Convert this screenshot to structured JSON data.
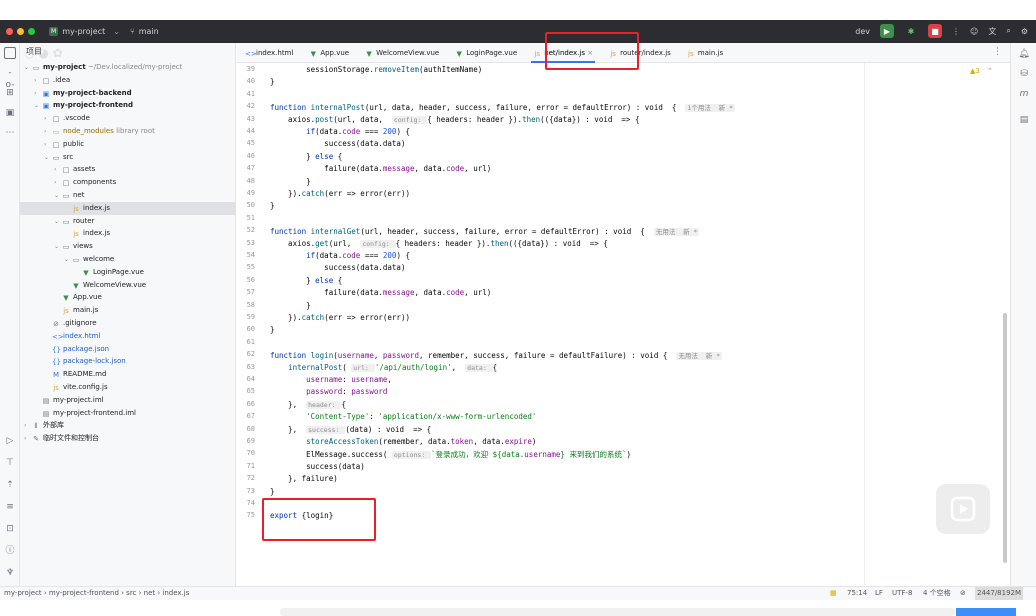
{
  "window": {
    "project_badge": "M",
    "project_name": "my-project",
    "branch": "main",
    "run_config": "dev"
  },
  "project_panel": {
    "title": "项目",
    "tree": [
      {
        "label": "my-project",
        "hint": "~/Dev.localized/my-project",
        "depth": 0,
        "kind": "folder-open",
        "bold": true
      },
      {
        "label": ".idea",
        "depth": 1,
        "kind": "folder"
      },
      {
        "label": "my-project-backend",
        "depth": 1,
        "kind": "module",
        "bold": true
      },
      {
        "label": "my-project-frontend",
        "depth": 1,
        "kind": "module-open",
        "bold": true
      },
      {
        "label": ".vscode",
        "depth": 2,
        "kind": "folder"
      },
      {
        "label": "node_modules",
        "hint": "library root",
        "depth": 2,
        "kind": "folder-lib"
      },
      {
        "label": "public",
        "depth": 2,
        "kind": "folder"
      },
      {
        "label": "src",
        "depth": 2,
        "kind": "folder-open"
      },
      {
        "label": "assets",
        "depth": 3,
        "kind": "folder"
      },
      {
        "label": "components",
        "depth": 3,
        "kind": "folder"
      },
      {
        "label": "net",
        "depth": 3,
        "kind": "folder-open"
      },
      {
        "label": "index.js",
        "depth": 4,
        "kind": "js",
        "selected": true
      },
      {
        "label": "router",
        "depth": 3,
        "kind": "folder-open"
      },
      {
        "label": "index.js",
        "depth": 4,
        "kind": "js"
      },
      {
        "label": "views",
        "depth": 3,
        "kind": "folder-open"
      },
      {
        "label": "welcome",
        "depth": 4,
        "kind": "folder-open"
      },
      {
        "label": "LoginPage.vue",
        "depth": 5,
        "kind": "vue"
      },
      {
        "label": "WelcomeView.vue",
        "depth": 4,
        "kind": "vue"
      },
      {
        "label": "App.vue",
        "depth": 3,
        "kind": "vue"
      },
      {
        "label": "main.js",
        "depth": 3,
        "kind": "js"
      },
      {
        "label": ".gitignore",
        "depth": 2,
        "kind": "git"
      },
      {
        "label": "index.html",
        "depth": 2,
        "kind": "html"
      },
      {
        "label": "package.json",
        "depth": 2,
        "kind": "json"
      },
      {
        "label": "package-lock.json",
        "depth": 2,
        "kind": "json"
      },
      {
        "label": "README.md",
        "depth": 2,
        "kind": "md"
      },
      {
        "label": "vite.config.js",
        "depth": 2,
        "kind": "js"
      },
      {
        "label": "my-project.iml",
        "depth": 1,
        "kind": "iml"
      },
      {
        "label": "my-project-frontend.iml",
        "depth": 1,
        "kind": "iml"
      },
      {
        "label": "外部库",
        "depth": 0,
        "kind": "lib"
      },
      {
        "label": "临时文件和控制台",
        "depth": 0,
        "kind": "scratch"
      }
    ]
  },
  "tabs": [
    {
      "label": "index.html",
      "kind": "html"
    },
    {
      "label": "App.vue",
      "kind": "vue"
    },
    {
      "label": "WelcomeView.vue",
      "kind": "vue"
    },
    {
      "label": "LoginPage.vue",
      "kind": "vue"
    },
    {
      "label": "net/index.js",
      "kind": "js",
      "active": true
    },
    {
      "label": "router/index.js",
      "kind": "js"
    },
    {
      "label": "main.js",
      "kind": "js"
    }
  ],
  "editor": {
    "warnings": "▲3",
    "line_numbers": [
      "39",
      "40",
      "41",
      "42",
      "43",
      "44",
      "45",
      "46",
      "47",
      "48",
      "49",
      "50",
      "51",
      "52",
      "53",
      "54",
      "55",
      "56",
      "57",
      "58",
      "59",
      "60",
      "61",
      "62",
      "63",
      "64",
      "65",
      "66",
      "67",
      "68",
      "69",
      "70",
      "71",
      "72",
      "73",
      "74",
      "75"
    ],
    "lines": [
      "        sessionStorage.removeItem(authItemName)",
      "}",
      "",
      "function internalPost(url, data, header, success, failure, error = defaultError) : void  {  1个用法  新 *",
      "    axios.post(url, data,  config: { headers: header }).then(({data}) : void  => {",
      "        if(data.code === 200) {",
      "            success(data.data)",
      "        } else {",
      "            failure(data.message, data.code, url)",
      "        }",
      "    }).catch(err => error(err))",
      "}",
      "",
      "function internalGet(url, header, success, failure, error = defaultError) : void  {  无用法  新 *",
      "    axios.get(url,  config: { headers: header }).then(({data}) : void  => {",
      "        if(data.code === 200) {",
      "            success(data.data)",
      "        } else {",
      "            failure(data.message, data.code, url)",
      "        }",
      "    }).catch(err => error(err))",
      "}",
      "",
      "function login(username, password, remember, success, failure = defaultFailure) : void {  无用法  新 *",
      "    internalPost( url: '/api/auth/login',  data: {",
      "        username: username,",
      "        password: password",
      "    },  header: {",
      "        'Content-Type': 'application/x-www-form-urlencoded'",
      "    },  success: (data) : void  => {",
      "        storeAccessToken(remember, data.token, data.expire)",
      "        ElMessage.success( options: `登录成功，欢迎 ${data.username} 来到我们的系统`)",
      "        success(data)",
      "    }, failure)",
      "}",
      "",
      "export {login}"
    ]
  },
  "status_bar": {
    "breadcrumb": [
      "my-project",
      "my-project-frontend",
      "src",
      "net",
      "index.js"
    ],
    "position": "75:14",
    "line_sep": "LF",
    "encoding": "UTF-8",
    "indent": "4 个空格",
    "memory": "2447/8192M"
  },
  "colors": {
    "highlight_box": "#e8202a",
    "active_tab_underline": "#3574f0",
    "titlebar_bg": "#2b2d30"
  }
}
